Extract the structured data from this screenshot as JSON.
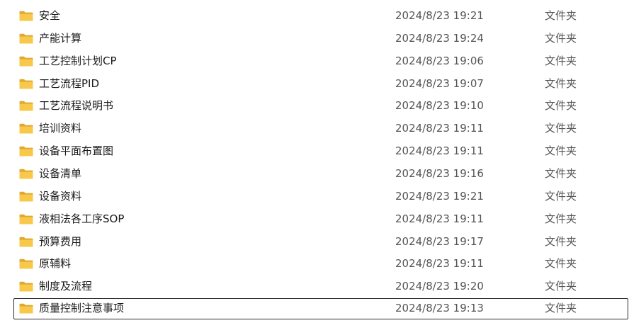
{
  "folders": [
    {
      "name": "安全",
      "date": "2024/8/23 19:21",
      "type": "文件夹"
    },
    {
      "name": "产能计算",
      "date": "2024/8/23 19:24",
      "type": "文件夹"
    },
    {
      "name": "工艺控制计划CP",
      "date": "2024/8/23 19:06",
      "type": "文件夹"
    },
    {
      "name": "工艺流程PID",
      "date": "2024/8/23 19:07",
      "type": "文件夹"
    },
    {
      "name": "工艺流程说明书",
      "date": "2024/8/23 19:10",
      "type": "文件夹"
    },
    {
      "name": "培训资料",
      "date": "2024/8/23 19:11",
      "type": "文件夹"
    },
    {
      "name": "设备平面布置图",
      "date": "2024/8/23 19:11",
      "type": "文件夹"
    },
    {
      "name": "设备清单",
      "date": "2024/8/23 19:16",
      "type": "文件夹"
    },
    {
      "name": "设备资料",
      "date": "2024/8/23 19:21",
      "type": "文件夹"
    },
    {
      "name": "液相法各工序SOP",
      "date": "2024/8/23 19:11",
      "type": "文件夹"
    },
    {
      "name": "预算费用",
      "date": "2024/8/23 19:17",
      "type": "文件夹"
    },
    {
      "name": "原辅料",
      "date": "2024/8/23 19:11",
      "type": "文件夹"
    },
    {
      "name": "制度及流程",
      "date": "2024/8/23 19:20",
      "type": "文件夹"
    },
    {
      "name": "质量控制注意事项",
      "date": "2024/8/23 19:13",
      "type": "文件夹"
    }
  ],
  "selected_item": "质量控制注意事项",
  "icon": "folder-icon",
  "colors": {
    "folder_front": "#f8c84a",
    "folder_back": "#e0a82e",
    "selection_border": "#2b2b2b"
  }
}
